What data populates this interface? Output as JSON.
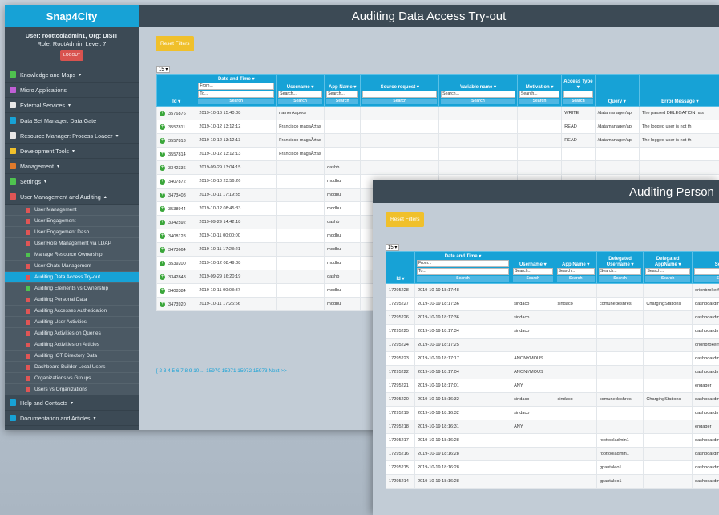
{
  "sidebar": {
    "brand": "Snap4City",
    "user_line": "User: roottooladmin1, Org: DISIT",
    "role_line": "Role: RootAdmin, Level: 7",
    "logout": "LOGOUT",
    "menu": [
      {
        "label": "Knowledge and Maps",
        "caret": "▾",
        "color": "#4fc24f"
      },
      {
        "label": "Micro Applications",
        "caret": "",
        "color": "#c05fd6"
      },
      {
        "label": "External Services",
        "caret": "▾",
        "color": "#e8e8e8"
      },
      {
        "label": "Data Set Manager: Data Gate",
        "caret": "",
        "color": "#17a2d6"
      },
      {
        "label": "Resource Manager: Process Loader",
        "caret": "▾",
        "color": "#e8e8e8"
      },
      {
        "label": "Development Tools",
        "caret": "▾",
        "color": "#f0c02b"
      },
      {
        "label": "Management",
        "caret": "▾",
        "color": "#e07a2b"
      },
      {
        "label": "Settings",
        "caret": "▾",
        "color": "#4fc24f"
      },
      {
        "label": "User Management and Auditing",
        "caret": "▴",
        "color": "#e05555"
      }
    ],
    "submenu": [
      {
        "label": "User Management",
        "green": false,
        "active": false
      },
      {
        "label": "User Engagement",
        "green": false,
        "active": false
      },
      {
        "label": "User Engagement Dash",
        "green": false,
        "active": false
      },
      {
        "label": "User Role Management via LDAP",
        "green": false,
        "active": false
      },
      {
        "label": "Manage Resource Ownership",
        "green": true,
        "active": false
      },
      {
        "label": "User Chats Management",
        "green": false,
        "active": false
      },
      {
        "label": "Auditing Data Access Try-out",
        "green": false,
        "active": true
      },
      {
        "label": "Auditing Elements vs Ownership",
        "green": true,
        "active": false
      },
      {
        "label": "Auditing Personal Data",
        "green": false,
        "active": false
      },
      {
        "label": "Auditing Accesses Authetication",
        "green": false,
        "active": false
      },
      {
        "label": "Auditing User Activities",
        "green": false,
        "active": false
      },
      {
        "label": "Auditing Activities on Queries",
        "green": false,
        "active": false
      },
      {
        "label": "Auditing Activities on Articles",
        "green": false,
        "active": false
      },
      {
        "label": "Auditing IOT Directory Data",
        "green": false,
        "active": false
      },
      {
        "label": "Dashboard Builder Local Users",
        "green": false,
        "active": false
      },
      {
        "label": "Organizations vs Groups",
        "green": false,
        "active": false
      },
      {
        "label": "Users vs Organizations",
        "green": false,
        "active": false
      }
    ],
    "bottom": [
      {
        "label": "Help and Contacts",
        "caret": "▾",
        "color": "#17a2d6"
      },
      {
        "label": "Documentation and Articles",
        "caret": "▾",
        "color": "#17a2d6"
      },
      {
        "label": "My Profile",
        "caret": "▾",
        "color": "#e05555"
      }
    ]
  },
  "main": {
    "title": "Auditing Data Access Try-out",
    "reset": "Reset Filters",
    "page_size": "15 ▾",
    "headers": [
      "Id ▾",
      "Date and Time ▾",
      "Username ▾",
      "App Name ▾",
      "Source request ▾",
      "Variable name ▾",
      "Motivation ▾",
      "Access Type ▾",
      "Query ▾",
      "Error Message ▾",
      "St"
    ],
    "placeholders": {
      "from": "From...",
      "to": "To...",
      "search": "Search...",
      "btn": "Search"
    },
    "rows": [
      [
        "3576876",
        "2019-10-16 15:40:08",
        "namenkapoor",
        "",
        "",
        "",
        "",
        "WRITE",
        "/datamanager/ap",
        "The passed DELEGATION has",
        "edu"
      ],
      [
        "3557811",
        "2019-10-12 13:12:12",
        "Francisco magaÃ±as",
        "",
        "",
        "",
        "",
        "READ",
        "/datamanager/ap",
        "The logged user is not th",
        "edu"
      ],
      [
        "3557813",
        "2019-10-12 13:12:13",
        "Francisco magaÃ±as",
        "",
        "",
        "",
        "",
        "READ",
        "/datamanager/ap",
        "The logged user is not th",
        "edu"
      ],
      [
        "3557814",
        "2019-10-12 13:12:13",
        "Francisco magaÃ±as",
        "",
        "",
        "",
        "",
        "",
        "",
        "",
        ""
      ],
      [
        "3342336",
        "2019-09-29 13:04:15",
        "",
        "dashb",
        "",
        "",
        "",
        "",
        "",
        "",
        ""
      ],
      [
        "3407872",
        "2019-10-10 23:56:26",
        "",
        "modbu",
        "",
        "",
        "",
        "",
        "",
        "",
        ""
      ],
      [
        "3473408",
        "2019-10-11 17:19:35",
        "",
        "modbu",
        "",
        "",
        "",
        "",
        "",
        "",
        ""
      ],
      [
        "3538944",
        "2019-10-12 08:45:33",
        "",
        "modbu",
        "",
        "",
        "",
        "",
        "",
        "",
        ""
      ],
      [
        "3342592",
        "2019-09-29 14:42:18",
        "",
        "dashb",
        "",
        "",
        "",
        "",
        "",
        "",
        ""
      ],
      [
        "3408128",
        "2019-10-11 00:00:00",
        "",
        "modbu",
        "",
        "",
        "",
        "",
        "",
        "",
        ""
      ],
      [
        "3473664",
        "2019-10-11 17:23:21",
        "",
        "modbu",
        "",
        "",
        "",
        "",
        "",
        "",
        ""
      ],
      [
        "3539200",
        "2019-10-12 08:49:08",
        "",
        "modbu",
        "",
        "",
        "",
        "",
        "",
        "",
        ""
      ],
      [
        "3342848",
        "2019-09-29 16:20:19",
        "",
        "dashb",
        "",
        "",
        "",
        "",
        "",
        "",
        ""
      ],
      [
        "3408384",
        "2019-10-11 00:03:37",
        "",
        "modbu",
        "",
        "",
        "",
        "",
        "",
        "",
        ""
      ],
      [
        "3473920",
        "2019-10-11 17:26:56",
        "",
        "modbu",
        "",
        "",
        "",
        "",
        "",
        "",
        ""
      ]
    ],
    "pager": "[ 2 3 4 5 6 7 8 9 10 ... 15970 15971 15972 15973 Next >> "
  },
  "second": {
    "title": "Auditing Person",
    "reset": "Reset Filters",
    "page_size": "15 ▾",
    "headers": [
      "Id ▾",
      "Date and Time ▾",
      "Username ▾",
      "App Name ▾",
      "Delegated Username ▾",
      "Delegated AppName ▾",
      "Source"
    ],
    "rows": [
      [
        "17295228",
        "2019-10-19 18:17:48",
        "",
        "",
        "",
        "",
        "orionbrokerfilter"
      ],
      [
        "17295227",
        "2019-10-19 18:17:36",
        "sindaco",
        "sindaco",
        "comunedeshres",
        "ChargingStations",
        "dashboardmana"
      ],
      [
        "17295226",
        "2019-10-19 18:17:36",
        "sindaco",
        "",
        "",
        "",
        "dashboardmana"
      ],
      [
        "17295225",
        "2019-10-19 18:17:34",
        "sindaco",
        "",
        "",
        "",
        "dashboardmana"
      ],
      [
        "17295224",
        "2019-10-19 18:17:25",
        "",
        "",
        "",
        "",
        "orionbrokerfilter"
      ],
      [
        "17295223",
        "2019-10-19 18:17:17",
        "ANONYMOUS",
        "",
        "",
        "",
        "dashboardmana"
      ],
      [
        "17295222",
        "2019-10-19 18:17:04",
        "ANONYMOUS",
        "",
        "",
        "",
        "dashboardmana"
      ],
      [
        "17295221",
        "2019-10-19 18:17:01",
        "ANY",
        "",
        "",
        "",
        "engager"
      ],
      [
        "17295220",
        "2019-10-19 18:16:32",
        "sindaco",
        "sindaco",
        "comunedeshres",
        "ChargingStations",
        "dashboardmana"
      ],
      [
        "17295219",
        "2019-10-19 18:16:32",
        "sindaco",
        "",
        "",
        "",
        "dashboardmana"
      ],
      [
        "17295218",
        "2019-10-19 18:16:31",
        "ANY",
        "",
        "",
        "",
        "engager"
      ],
      [
        "17295217",
        "2019-10-19 18:16:28",
        "",
        "",
        "roottooladmin1",
        "",
        "dashboardmana"
      ],
      [
        "17295216",
        "2019-10-19 18:16:28",
        "",
        "",
        "roottooladmin1",
        "",
        "dashboardmana"
      ],
      [
        "17295215",
        "2019-10-19 18:16:28",
        "",
        "",
        "gpantaleo1",
        "",
        "dashboardmana"
      ],
      [
        "17295214",
        "2019-10-19 18:16:28",
        "",
        "",
        "gpantaleo1",
        "",
        "dashboardmana"
      ]
    ]
  }
}
